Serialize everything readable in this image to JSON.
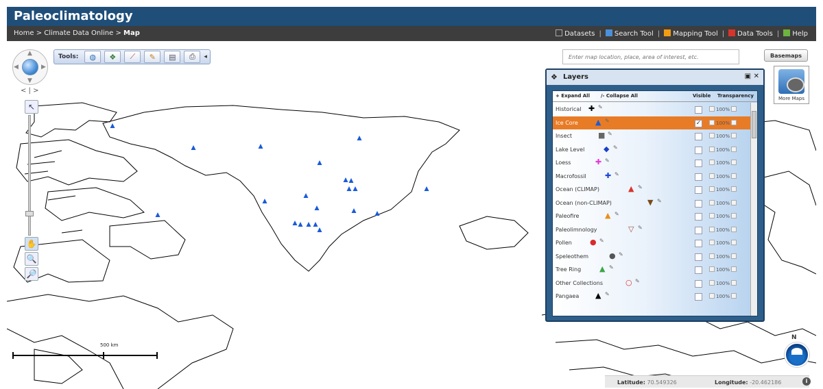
{
  "header": {
    "title": "Paleoclimatology",
    "breadcrumb_1": "Home",
    "breadcrumb_2": "Climate Data Online",
    "breadcrumb_current": "Map",
    "links": [
      {
        "label": "Datasets",
        "color": "#3d3d3d"
      },
      {
        "label": "Search Tool",
        "color": "#4a90d9"
      },
      {
        "label": "Mapping Tool",
        "color": "#f39c12"
      },
      {
        "label": "Data Tools",
        "color": "#d9342b"
      },
      {
        "label": "Help",
        "color": "#6db33f"
      }
    ]
  },
  "toolbar": {
    "label": "Tools:",
    "icons": [
      "globe-icon",
      "layers-icon",
      "measure-icon",
      "draw-icon",
      "export-icon",
      "print-icon"
    ]
  },
  "search": {
    "placeholder": "Enter map location, place, area of interest, etc."
  },
  "basemaps": {
    "button_label": "Basemaps",
    "more_maps_label": "More Maps"
  },
  "layers_panel": {
    "title": "Layers",
    "expand_all": "+ Expand All",
    "collapse_all": "/- Collapse All",
    "col_visible": "Visible",
    "col_transparency": "Transparency",
    "selected_layer": "Ice Core",
    "layers": [
      {
        "name": "Historical",
        "symbol": "✚",
        "color": "#000000",
        "visible": false,
        "transparency": "100%"
      },
      {
        "name": "Ice Core",
        "symbol": "▲",
        "color": "#1a5bd8",
        "visible": true,
        "transparency": "100%"
      },
      {
        "name": "Insect",
        "symbol": "■",
        "color": "#666666",
        "visible": false,
        "transparency": "100%"
      },
      {
        "name": "Lake Level",
        "symbol": "◆",
        "color": "#1a3fc9",
        "visible": false,
        "transparency": "100%"
      },
      {
        "name": "Loess",
        "symbol": "✚",
        "color": "#e33cd6",
        "visible": false,
        "transparency": "100%"
      },
      {
        "name": "Macrofossil",
        "symbol": "✚",
        "color": "#1a47d8",
        "visible": false,
        "transparency": "100%"
      },
      {
        "name": "Ocean (CLIMAP)",
        "symbol": "▲",
        "color": "#d9342b",
        "visible": false,
        "transparency": "100%"
      },
      {
        "name": "Ocean (non-CLIMAP)",
        "symbol": "▼",
        "color": "#7a4a1a",
        "visible": false,
        "transparency": "100%"
      },
      {
        "name": "Paleofire",
        "symbol": "▲",
        "color": "#e8901a",
        "visible": false,
        "transparency": "100%"
      },
      {
        "name": "Paleolimnology",
        "symbol": "▽",
        "color": "#a0503a",
        "visible": false,
        "transparency": "100%"
      },
      {
        "name": "Pollen",
        "symbol": "●",
        "color": "#d92b2b",
        "visible": false,
        "transparency": "100%"
      },
      {
        "name": "Speleothem",
        "symbol": "●",
        "color": "#555555",
        "visible": false,
        "transparency": "100%"
      },
      {
        "name": "Tree Ring",
        "symbol": "▲",
        "color": "#3aa845",
        "visible": false,
        "transparency": "100%"
      },
      {
        "name": "Other Collections",
        "symbol": "○",
        "color": "#d9342b",
        "visible": false,
        "transparency": "100%"
      },
      {
        "name": "Pangaea",
        "symbol": "▲",
        "color": "#000000",
        "visible": false,
        "transparency": "100%"
      }
    ]
  },
  "scale": {
    "label": "500 km"
  },
  "status": {
    "latitude_label": "Latitude:",
    "latitude_value": "70.549326",
    "longitude_label": "Longitude:",
    "longitude_value": "-20.462186"
  },
  "colors": {
    "title_bar": "#1f4e79",
    "nav_bar": "#3d3d3d",
    "selected_row": "#e87b26",
    "marker": "#1a5bd8"
  }
}
